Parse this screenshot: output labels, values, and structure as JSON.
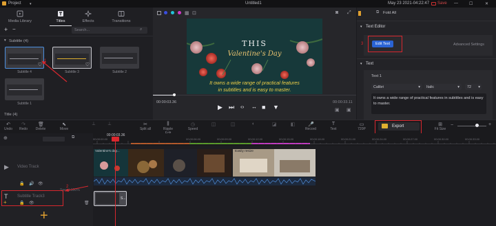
{
  "titlebar": {
    "project_menu": "Project",
    "window_title": "Untitled1",
    "date_time": "May 23 2021-04:22:47",
    "save_label": "Save"
  },
  "library": {
    "tabs": [
      {
        "label": "Media Library",
        "icon": "media-library-icon"
      },
      {
        "label": "Titles",
        "icon": "titles-icon"
      },
      {
        "label": "Effects",
        "icon": "effects-icon"
      },
      {
        "label": "Transitions",
        "icon": "transitions-icon"
      }
    ],
    "search_placeholder": "Search...",
    "section_subtitle": "Subtitle (4)",
    "section_title": "Title (4)",
    "thumbs": [
      {
        "caption": "Subtitle 4"
      },
      {
        "caption": "Subtitle 3"
      },
      {
        "caption": "Subtitle 2"
      },
      {
        "caption": "Subtitle 1"
      }
    ]
  },
  "preview": {
    "video_line1": "THIS",
    "video_line2": "Valentine's Day",
    "caption_line1": "It owns a wide range of practical features",
    "caption_line2": "in subtitles and is easy to master.",
    "current_time": "00:00:03.36",
    "total_time": "00:00:33.11",
    "dot_colors": [
      "#3a4ee0",
      "#23c3d8",
      "#d238c9"
    ]
  },
  "right_panel": {
    "fold_all": "Fold All",
    "text_editor_header": "Text Editor",
    "edit_text_button": "Edit Text",
    "advanced_settings": "Advanced Settings",
    "text_header": "Text",
    "text1_label": "Text 1",
    "font_value": "Calibri",
    "style_value": "Italic",
    "size_value": "72",
    "text_body": "It owns a wide range of practical features in subtitles and is easy to master."
  },
  "annotations": {
    "step1": "1",
    "step2": "2",
    "step3": "3",
    "accent": "#d9272e"
  },
  "toolbar": {
    "tools": [
      "Undo",
      "Redo",
      "Delete",
      "Move",
      "",
      "",
      "Split all",
      "",
      "Ripple Edit",
      "Speed",
      "",
      "",
      "",
      "",
      "",
      "Record",
      "Text",
      "",
      "",
      "720P"
    ],
    "export_label": "Export",
    "fit_size": "Fit Size"
  },
  "timeline": {
    "playhead_time": "00:00:03.36",
    "ruler_labels": [
      "00:00:00.00",
      "00:00:03.00",
      "00:00:05.00",
      "00:00:06.00",
      "00:00:09.00",
      "00:00:12.00",
      "00:00:15.00",
      "00:00:18.00",
      "00:00:21.00",
      "00:00:24.00",
      "00:00:27.00",
      "00:00:30.00",
      "00:00:33.00",
      "00:00:36.00"
    ],
    "video_track_label": "Video Track",
    "video_clip1_label": "Valentine's day...",
    "video_clip2_label": "Easily resize",
    "subtitle_track_label": "Subtitle Track3",
    "subtitle_track_speed": "Speed:100%",
    "subtitle_clip_label": "S..."
  }
}
